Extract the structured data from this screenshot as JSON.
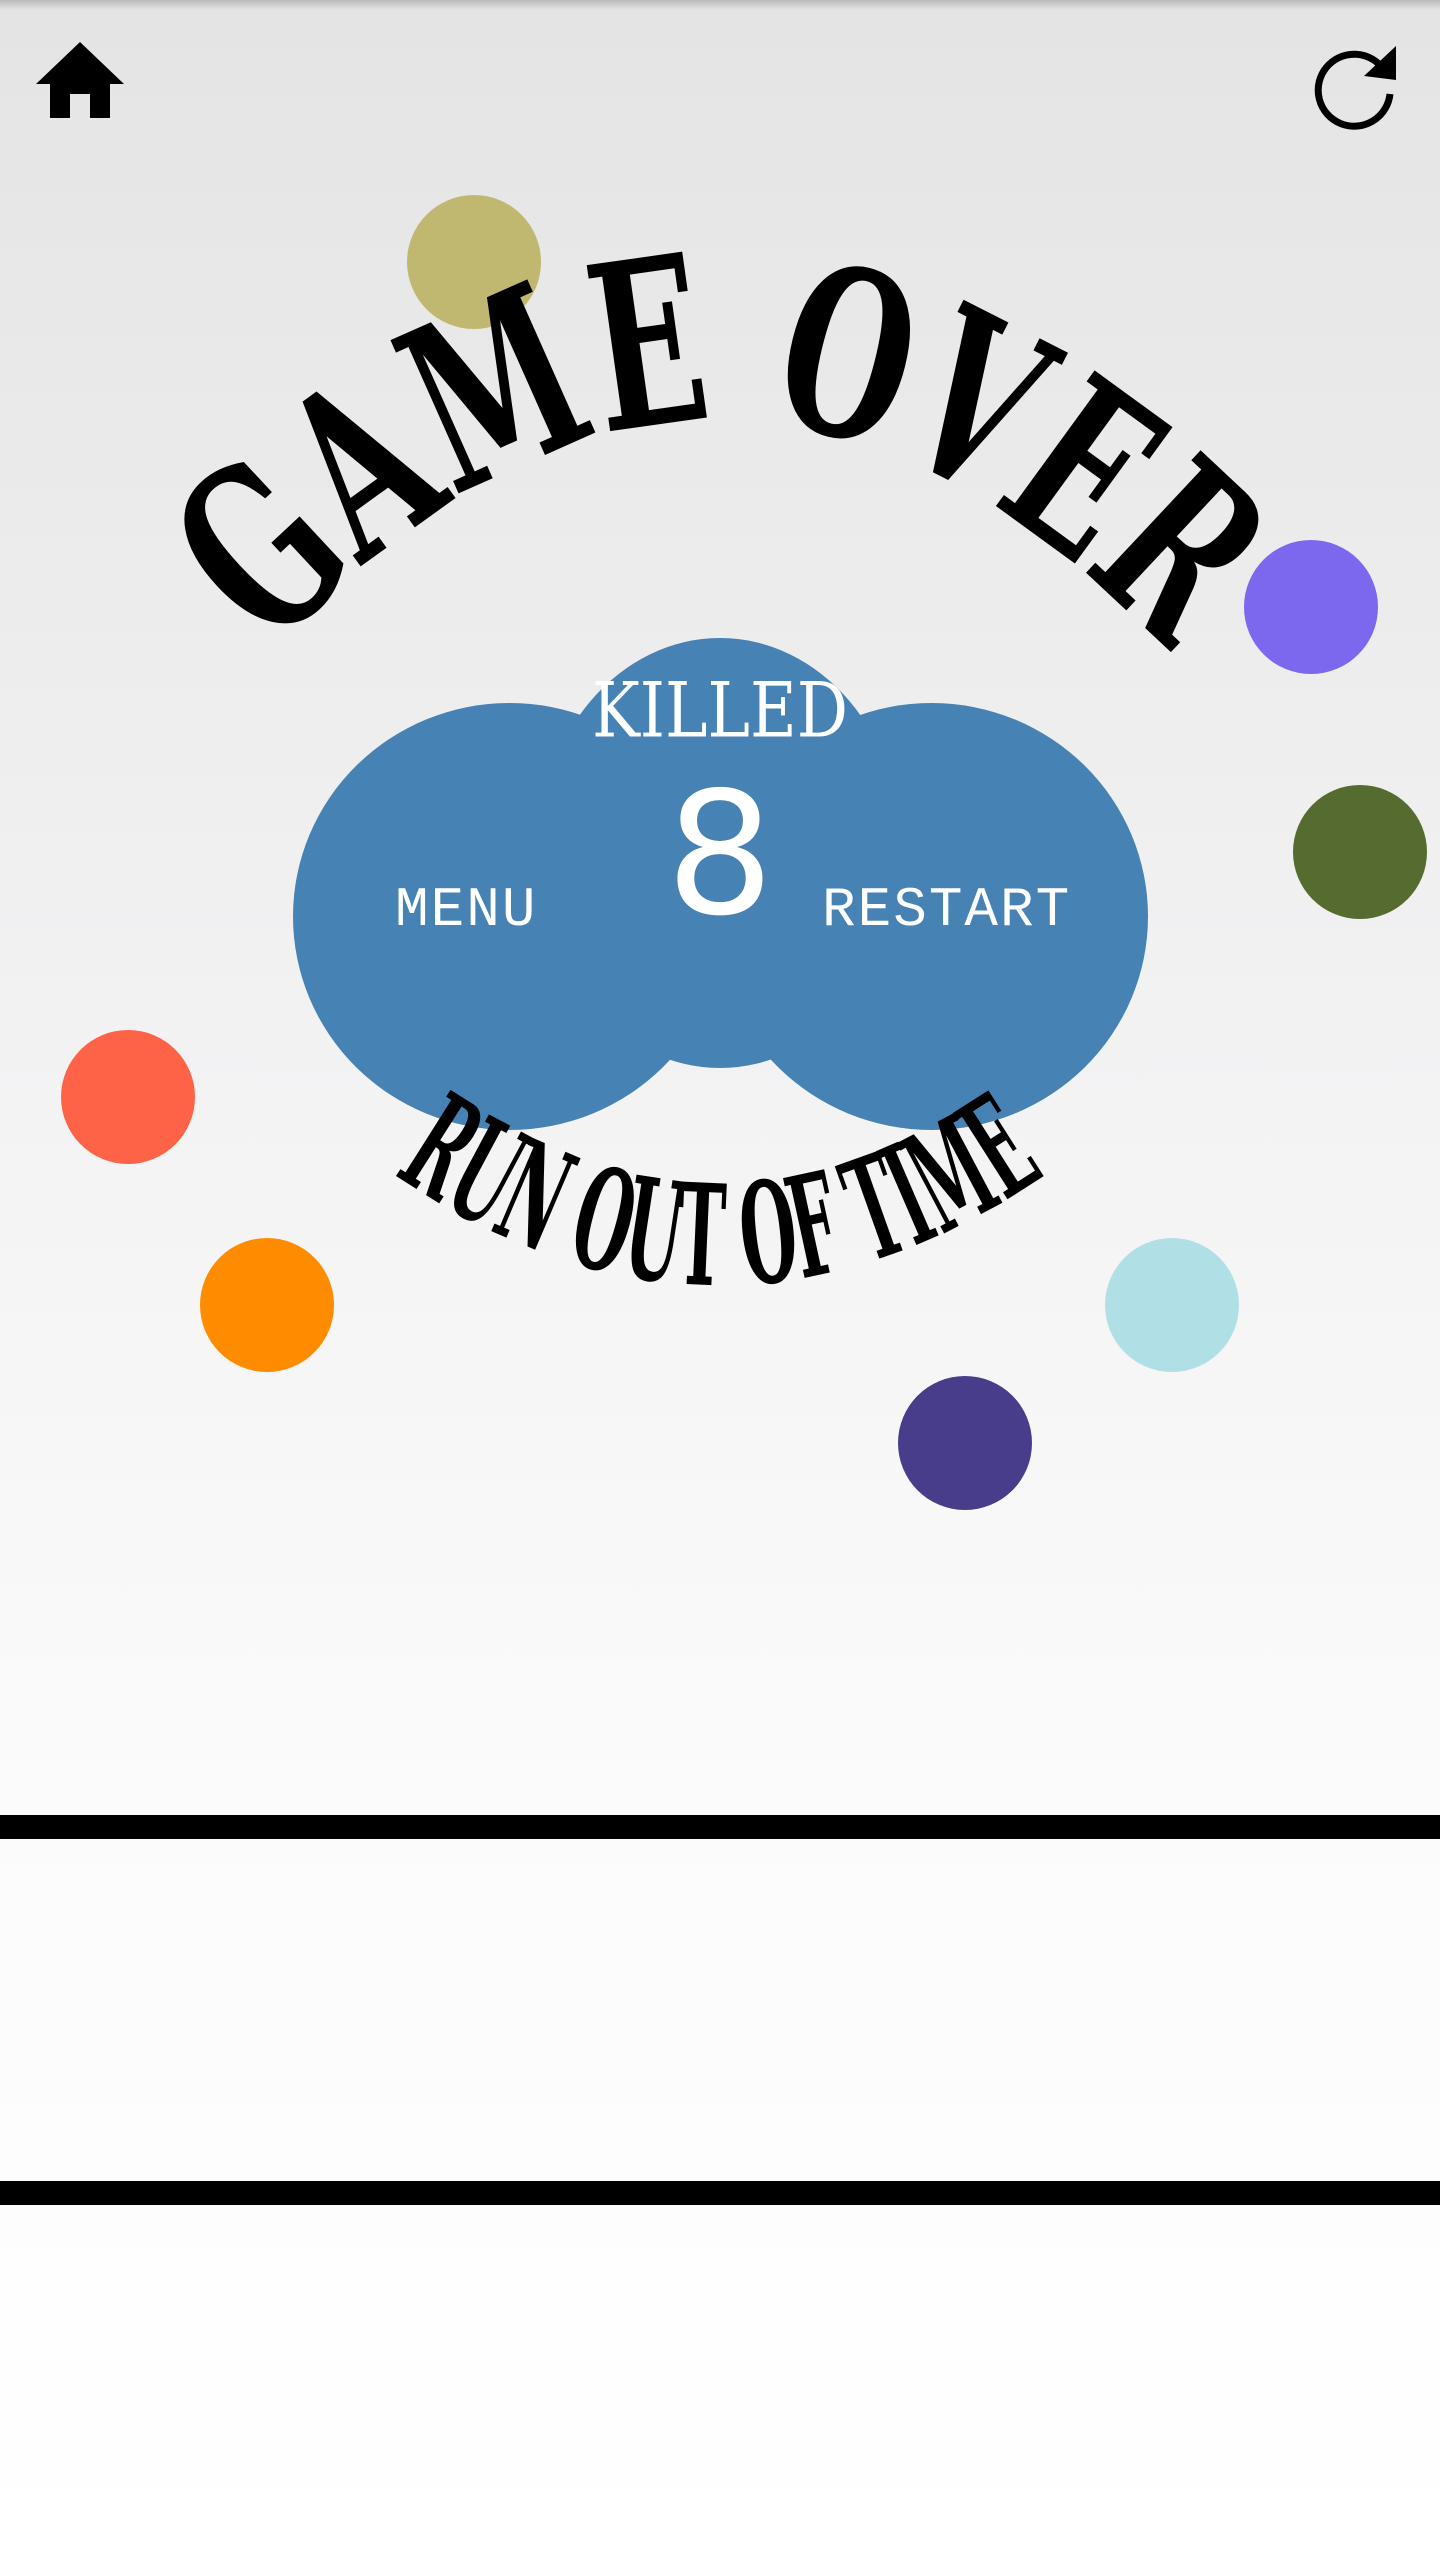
{
  "header": {
    "home_icon": "home-icon",
    "restart_icon": "restart-icon"
  },
  "title": {
    "game_over": "GAME OVER",
    "reason": "RUN OUT OF TIME"
  },
  "result": {
    "killed_label": "KILLED",
    "killed_count": "8",
    "menu_label": "MENU",
    "restart_label": "RESTART"
  },
  "colors": {
    "cloud": "#4682b4",
    "balls": [
      "#c0b871",
      "#7b68ee",
      "#556b2f",
      "#ff6347",
      "#ff8c00",
      "#b0e0e6",
      "#483d8b"
    ]
  }
}
